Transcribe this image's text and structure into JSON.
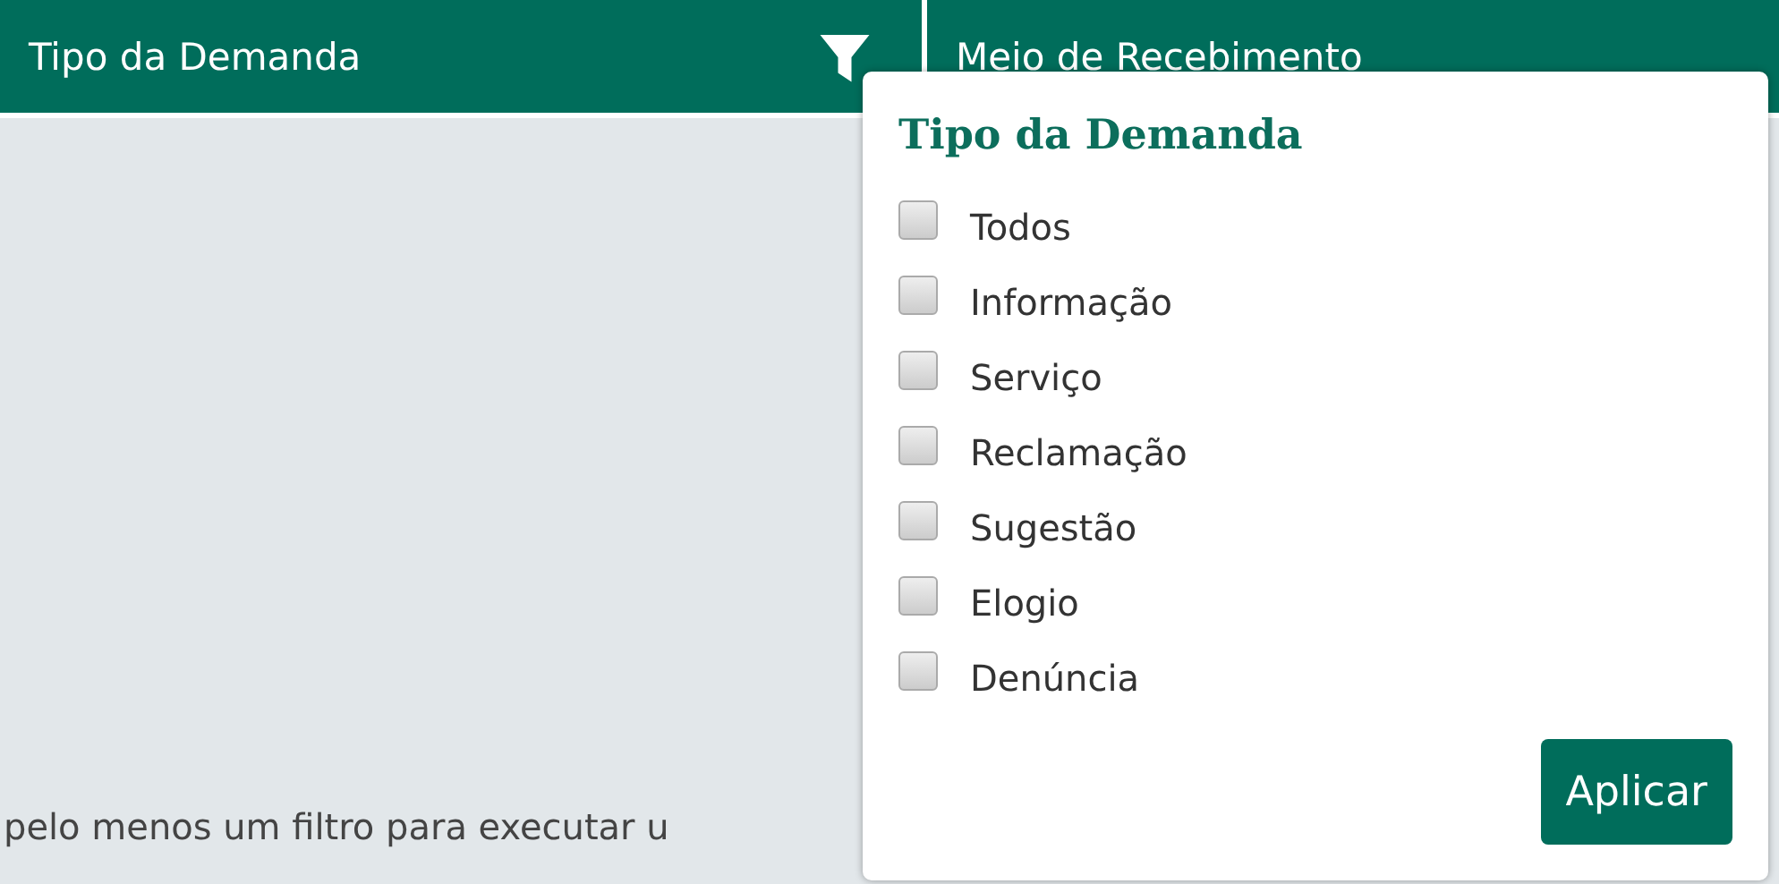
{
  "columns": [
    {
      "label": "Tipo da Demanda",
      "filter": true
    },
    {
      "label": "Meio de Recebimento",
      "filter": false
    }
  ],
  "message": "pelo menos um filtro para executar u",
  "popup": {
    "title": "Tipo da Demanda",
    "options": [
      {
        "label": "Todos",
        "checked": false
      },
      {
        "label": "Informação",
        "checked": false
      },
      {
        "label": "Serviço",
        "checked": false
      },
      {
        "label": "Reclamação",
        "checked": false
      },
      {
        "label": "Sugestão",
        "checked": false
      },
      {
        "label": "Elogio",
        "checked": false
      },
      {
        "label": "Denúncia",
        "checked": false
      }
    ],
    "button": "Aplicar"
  }
}
